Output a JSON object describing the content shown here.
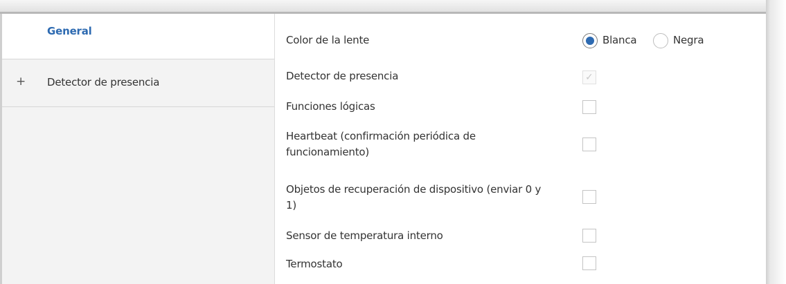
{
  "sidebar": {
    "items": [
      {
        "label": "General",
        "selected": true
      },
      {
        "label": "Detector de presencia",
        "expand_symbol": "+"
      }
    ]
  },
  "settings": {
    "lens_color": {
      "label": "Color de la lente",
      "options": [
        {
          "label": "Blanca",
          "selected": true
        },
        {
          "label": "Negra",
          "selected": false
        }
      ]
    },
    "checkboxes": [
      {
        "label": "Detector de presencia",
        "checked": true,
        "disabled": true,
        "check_glyph": "✓"
      },
      {
        "label": "Funciones lógicas",
        "checked": false
      },
      {
        "label": "Heartbeat (confirmación periódica de funcionamiento)",
        "checked": false
      },
      {
        "label": "Objetos de recuperación de dispositivo (enviar 0 y 1)",
        "checked": false
      },
      {
        "label": "Sensor de temperatura interno",
        "checked": false
      },
      {
        "label": "Termostato",
        "checked": false
      }
    ]
  },
  "colors": {
    "accent": "#2d6ab1",
    "sidebar_bg": "#f3f3f3",
    "text": "#333333"
  }
}
